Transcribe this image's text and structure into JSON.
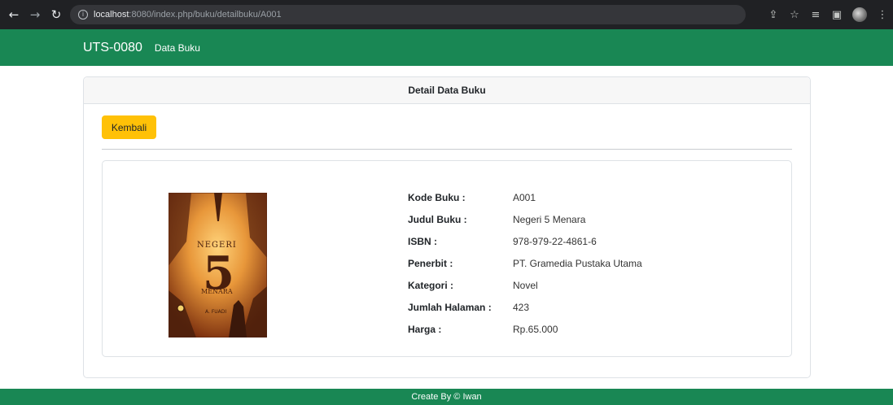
{
  "browser": {
    "url_host": "localhost",
    "url_rest": ":8080/index.php/buku/detailbuku/A001"
  },
  "navbar": {
    "brand": "UTS-0080",
    "link": "Data Buku"
  },
  "card": {
    "header": "Detail Data Buku",
    "back_label": "Kembali"
  },
  "book": {
    "cover_title": "NEGERI",
    "cover_number": "5",
    "cover_subtitle": "MENARA",
    "cover_author": "A. FUADI",
    "fields": [
      {
        "label": "Kode Buku :",
        "value": "A001"
      },
      {
        "label": "Judul Buku :",
        "value": "Negeri 5 Menara"
      },
      {
        "label": "ISBN :",
        "value": "978-979-22-4861-6"
      },
      {
        "label": "Penerbit :",
        "value": "PT. Gramedia Pustaka Utama"
      },
      {
        "label": "Kategori :",
        "value": "Novel"
      },
      {
        "label": "Jumlah Halaman :",
        "value": "423"
      },
      {
        "label": "Harga :",
        "value": "Rp.65.000"
      }
    ]
  },
  "footer": {
    "text": "Create By © Iwan"
  },
  "colors": {
    "primary_green": "#198754",
    "warning_yellow": "#ffc107"
  }
}
